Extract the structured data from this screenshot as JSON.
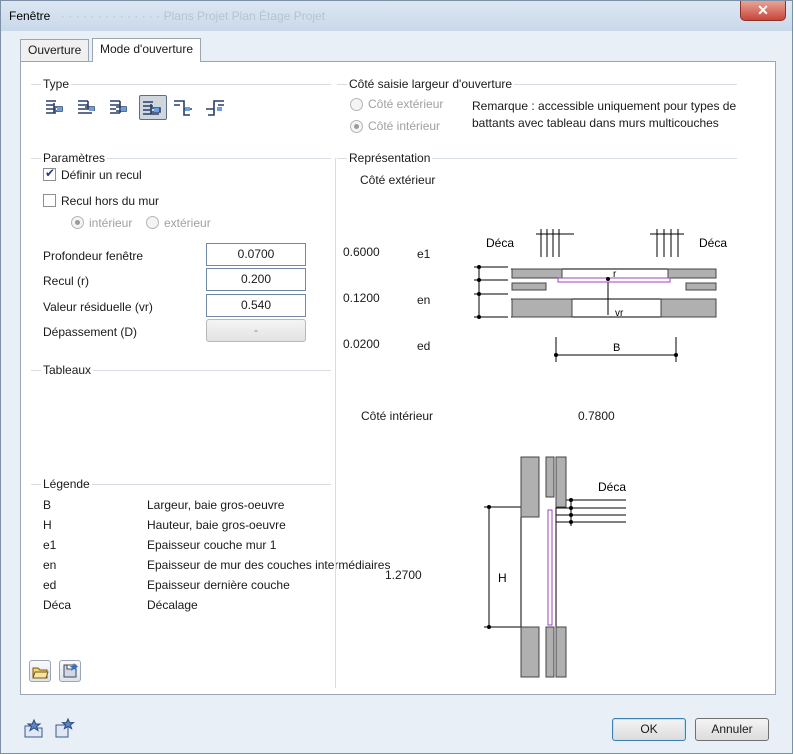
{
  "window": {
    "title": "Fenêtre",
    "ghost_title": "· · ·    · · · ·    ·  ·   · · · · ·    Plans Projet         Plan Étage Projet",
    "close_glyph": "✕"
  },
  "tabs": [
    {
      "label": "Ouverture",
      "active": false
    },
    {
      "label": "Mode d'ouverture",
      "active": true
    }
  ],
  "type_group": {
    "label": "Type",
    "icons": [
      "opening-type-1-icon",
      "opening-type-2-icon",
      "opening-type-3-icon",
      "opening-type-4-icon",
      "opening-type-5-icon",
      "opening-type-6-icon"
    ],
    "selected_index": 3
  },
  "side_group": {
    "label": "Côté saisie largeur d'ouverture",
    "radio_ext": "Côté extérieur",
    "radio_int": "Côté intérieur",
    "selected": "Côté intérieur",
    "remark_line1": "Remarque : accessible uniquement pour types de",
    "remark_line2": "battants avec tableau dans murs multicouches"
  },
  "params": {
    "label": "Paramètres",
    "define_recess": "Définir un recul",
    "define_recess_checked": true,
    "recess_outside": "Recul hors du mur",
    "recess_outside_checked": false,
    "radio_inner": "intérieur",
    "radio_outer": "extérieur",
    "radio_selected": "intérieur",
    "depth_label": "Profondeur fenêtre",
    "depth_value": "0.0700",
    "recess_label": "Recul (r)",
    "recess_value": "0.200",
    "residual_label": "Valeur résiduelle (vr)",
    "residual_value": "0.540",
    "overhang_label": "Dépassement (D)",
    "overhang_value": "-"
  },
  "tableaux": {
    "label": "Tableaux"
  },
  "legend": {
    "label": "Légende",
    "rows": [
      {
        "key": "B",
        "desc": "Largeur, baie gros-oeuvre"
      },
      {
        "key": "H",
        "desc": "Hauteur, baie gros-oeuvre"
      },
      {
        "key": "e1",
        "desc": "Epaisseur couche mur 1"
      },
      {
        "key": "en",
        "desc": "Epaisseur de mur des couches intermédiaires"
      },
      {
        "key": "ed",
        "desc": "Epaisseur dernière couche"
      },
      {
        "key": "Déca",
        "desc": "Décalage"
      }
    ]
  },
  "representation": {
    "label": "Représentation",
    "ext_side": "Côté extérieur",
    "int_side": "Côté intérieur",
    "e1_value": "0.6000",
    "en_value": "0.1200",
    "ed_value": "0.0200",
    "e1_label": "e1",
    "en_label": "en",
    "ed_label": "ed",
    "width_value": "0.7800",
    "height_value": "1.2700",
    "deca_left": "Déca",
    "deca_right": "Déca",
    "deca_bottom": "Déca",
    "r_label": "r",
    "vr_label": "vr",
    "b_label": "B",
    "h_label": "H"
  },
  "footer": {
    "ok": "OK",
    "cancel": "Annuler"
  },
  "colors": {
    "accent_purple": "#a040c0",
    "wall_gray": "#b0b0b0"
  }
}
